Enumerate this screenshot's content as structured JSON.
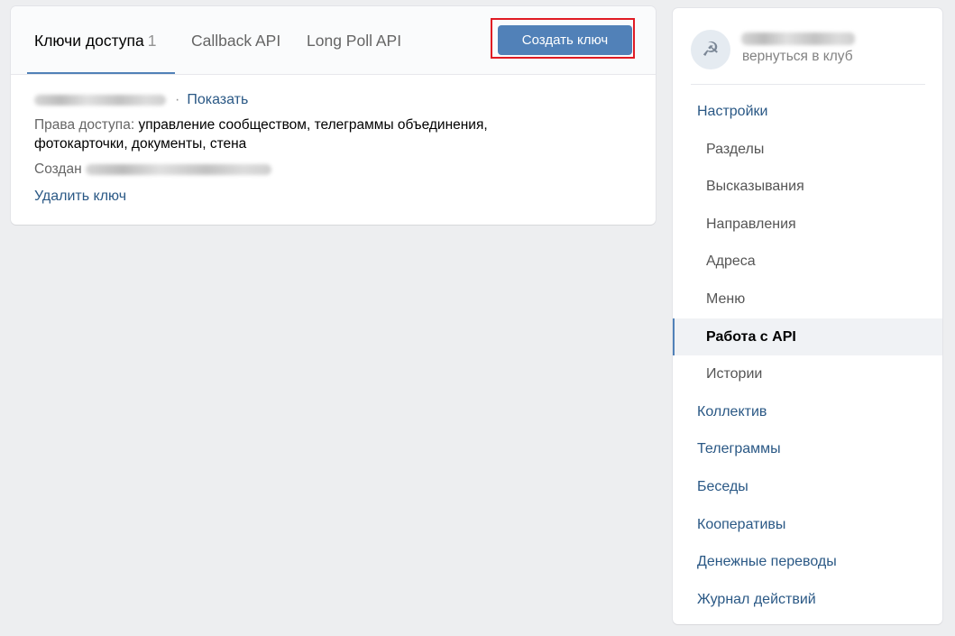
{
  "tabs": [
    {
      "label": "Ключи доступа",
      "count": "1"
    },
    {
      "label": "Callback API"
    },
    {
      "label": "Long Poll API"
    }
  ],
  "create_button_label": "Создать ключ",
  "key": {
    "separator": "·",
    "show_label": "Показать",
    "rights_label": "Права доступа:",
    "rights_value": "управление сообществом, телеграммы объединения, фотокарточки, документы, стена",
    "created_label": "Создан",
    "delete_label": "Удалить ключ"
  },
  "sidebar": {
    "avatar_symbol": "☭",
    "back_label": "вернуться в клуб",
    "items": [
      {
        "label": "Настройки"
      },
      {
        "label": "Разделы"
      },
      {
        "label": "Высказывания"
      },
      {
        "label": "Направления"
      },
      {
        "label": "Адреса"
      },
      {
        "label": "Меню"
      },
      {
        "label": "Работа с API"
      },
      {
        "label": "Истории"
      },
      {
        "label": "Коллектив"
      },
      {
        "label": "Телеграммы"
      },
      {
        "label": "Беседы"
      },
      {
        "label": "Кооперативы"
      },
      {
        "label": "Денежные переводы"
      },
      {
        "label": "Журнал действий"
      }
    ]
  },
  "colors": {
    "accent": "#5181b8",
    "link": "#2a5885",
    "highlight_frame": "#e01b24",
    "page_background": "#edeef0"
  }
}
